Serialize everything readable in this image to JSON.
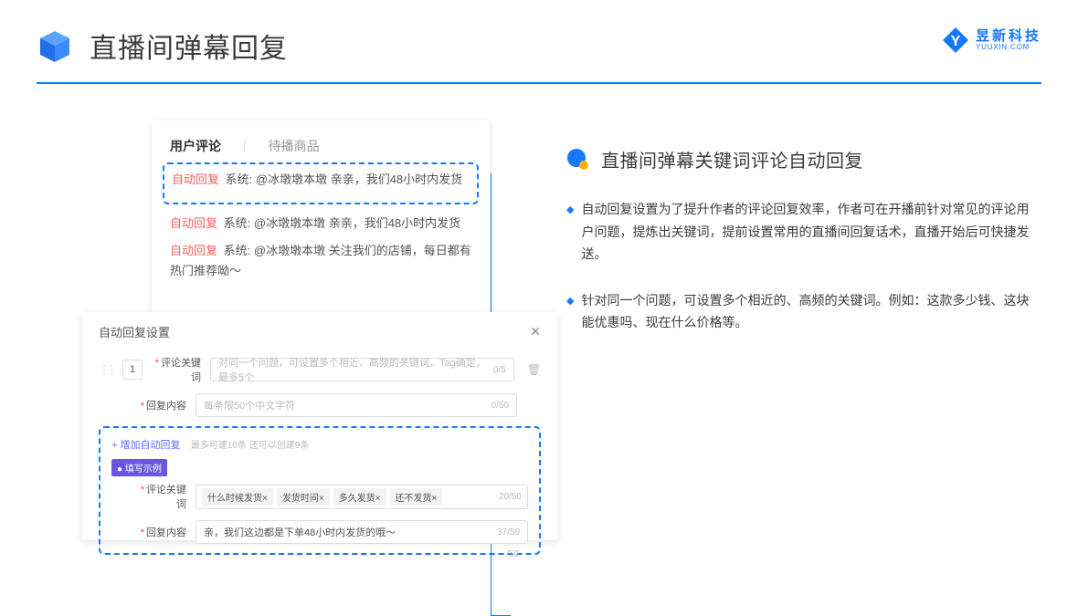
{
  "header": {
    "title": "直播间弹幕回复",
    "company_cn": "昱新科技",
    "company_en": "YUUXIN.COM"
  },
  "comments_panel": {
    "tab_user": "用户评论",
    "tab_goods": "待播商品",
    "rows": [
      {
        "tag": "自动回复",
        "sys": "系统:",
        "body": "@冰墩墩本墩 亲亲，我们48小时内发货"
      },
      {
        "tag": "自动回复",
        "sys": "系统:",
        "body": "@冰墩墩本墩 亲亲，我们48小时内发货"
      },
      {
        "tag": "自动回复",
        "sys": "系统:",
        "body": "@冰墩墩本墩 关注我们的店铺，每日都有热门推荐呦～"
      }
    ]
  },
  "settings_panel": {
    "title": "自动回复设置",
    "num": "1",
    "kw_label": "评论关键词",
    "kw_placeholder": "对同一个问题，可设置多个相近、高频的关键词，Tag确定，最多5个",
    "kw_counter": "0/5",
    "content_label": "回复内容",
    "content_placeholder": "每条限50个中文字符",
    "content_counter": "0/50",
    "add_link": "+ 增加自动回复",
    "add_hint": "最多可建10条 还可以创建9条",
    "example_badge": "● 填写示例",
    "ex_kw_label": "评论关键词",
    "ex_chips": [
      "什么时候发货×",
      "发货时间×",
      "多久发货×",
      "还不发货×"
    ],
    "ex_kw_counter": "20/50",
    "ex_content_label": "回复内容",
    "ex_content_value": "亲，我们这边都是下单48小时内发货的哦～",
    "ex_content_counter": "37/50",
    "outer_counter": "/50"
  },
  "right": {
    "section_title": "直播间弹幕关键词评论自动回复",
    "bullets": [
      "自动回复设置为了提升作者的评论回复效率，作者可在开播前针对常见的评论用户问题，提炼出关键词，提前设置常用的直播间回复话术，直播开始后可快捷发送。",
      "针对同一个问题，可设置多个相近的、高频的关键词。例如：这款多少钱、这块能优惠吗、现在什么价格等。"
    ]
  }
}
